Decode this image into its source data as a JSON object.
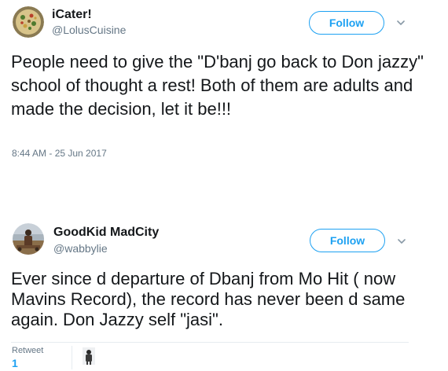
{
  "tweets": [
    {
      "name": "iCater!",
      "handle": "@LolusCuisine",
      "follow_label": "Follow",
      "text": "People need to give the \"D'banj go back to Don jazzy\" school of thought a rest! Both of them are adults and made the decision, let it be!!!",
      "timestamp": "8:44 AM - 25 Jun 2017"
    },
    {
      "name": "GoodKid MadCity",
      "handle": "@wabbylie",
      "follow_label": "Follow",
      "text": "Ever since d departure of Dbanj from Mo Hit ( now Mavins Record), the record has never been d same again. Don Jazzy self \"jasi\".",
      "retweet_label": "Retweet",
      "retweet_count": "1"
    }
  ],
  "colors": {
    "accent": "#1da1f2",
    "muted": "#657786",
    "text": "#14171a",
    "border": "#e6ecf0"
  },
  "icons": [
    "chevron-down-icon"
  ]
}
